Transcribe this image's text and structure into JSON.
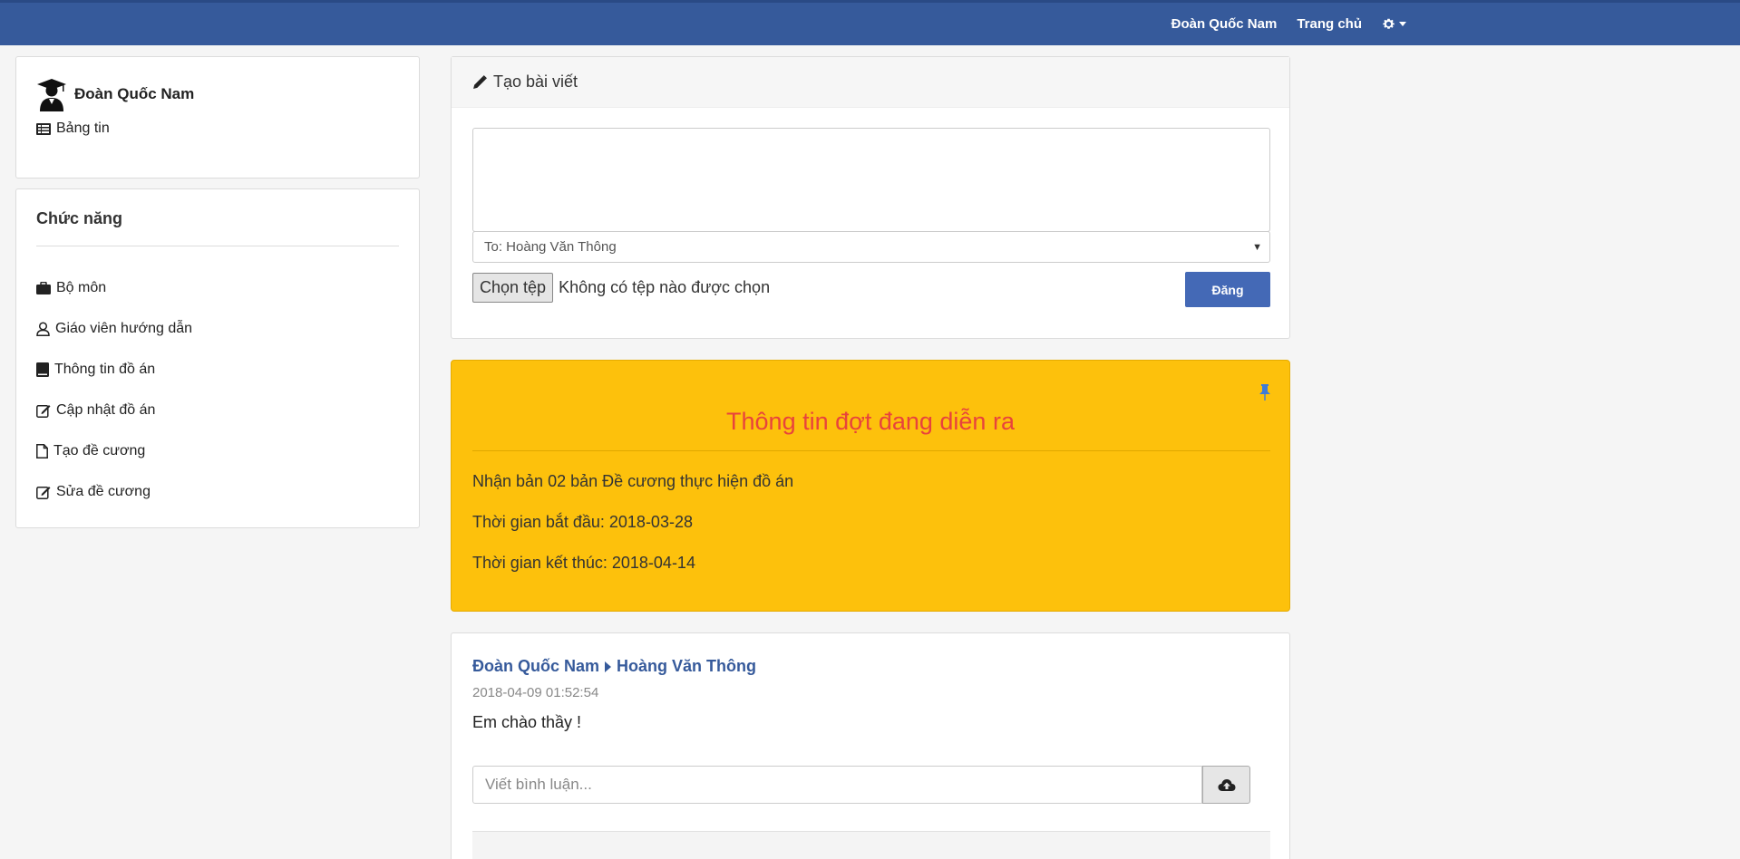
{
  "navbar": {
    "user_name": "Đoàn Quốc Nam",
    "home": "Trang chủ",
    "settings_icon": "gear-icon",
    "bg_color": "#365a9b"
  },
  "sidebar": {
    "user_name": "Đoàn Quốc Nam",
    "news_feed": "Bảng tin",
    "functions_title": "Chức năng",
    "items": [
      {
        "label": "Bộ môn",
        "icon": "briefcase-icon"
      },
      {
        "label": "Giáo viên hướng dẫn",
        "icon": "user-icon"
      },
      {
        "label": "Thông tin đồ án",
        "icon": "book-icon"
      },
      {
        "label": "Cập nhật đồ án",
        "icon": "edit-icon"
      },
      {
        "label": "Tạo đề cương",
        "icon": "file-icon"
      },
      {
        "label": "Sửa đề cương",
        "icon": "edit-icon"
      }
    ]
  },
  "post_form": {
    "title": "Tạo bài viết",
    "textarea_value": "",
    "to_select": "To: Hoàng Văn Thông",
    "file_button": "Chọn tệp",
    "file_status": "Không có tệp nào được chọn",
    "submit": "Đăng"
  },
  "notice": {
    "title": "Thông tin đợt đang diễn ra",
    "line1": "Nhận bản 02 bản Đề cương thực hiện đồ án",
    "line2": "Thời gian bắt đầu: 2018-03-28",
    "line3": "Thời gian kết thúc: 2018-04-14",
    "bg_color": "#fdc10c",
    "title_color": "#e8433c"
  },
  "feed": {
    "author": "Đoàn Quốc Nam",
    "recipient": "Hoàng Văn Thông",
    "timestamp": "2018-04-09 01:52:54",
    "content": "Em chào thầy !",
    "comment_placeholder": "Viết bình luận..."
  }
}
